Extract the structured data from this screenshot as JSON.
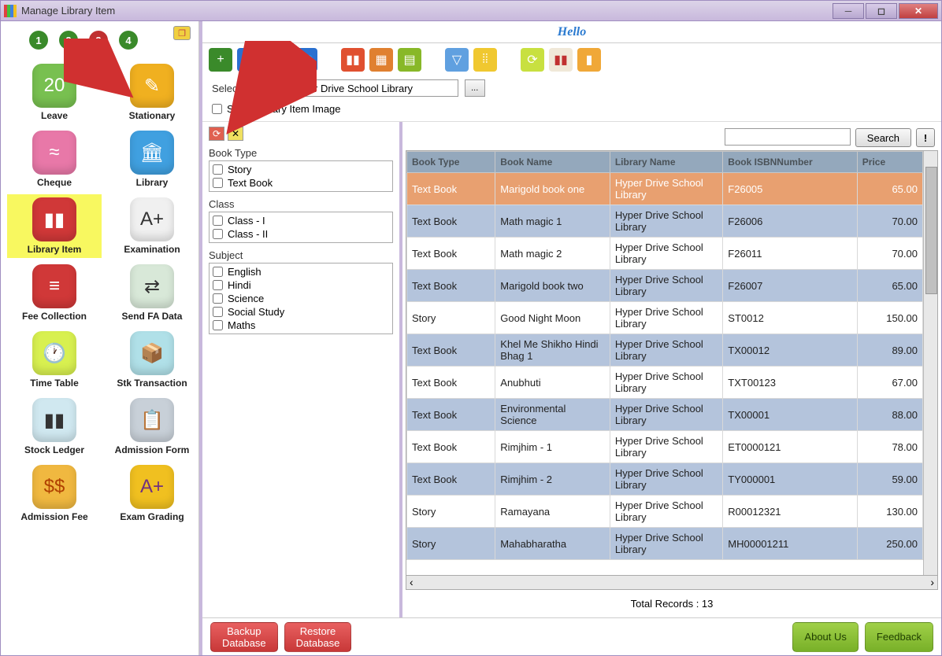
{
  "window": {
    "title": "Manage Library Item"
  },
  "header": {
    "hello": "Hello"
  },
  "steps": [
    "1",
    "2",
    "3",
    "4"
  ],
  "sidebar": [
    {
      "label": "Leave",
      "bg": "#78c050",
      "glyph": "20"
    },
    {
      "label": "Stationary",
      "bg": "#f0b020",
      "glyph": "✎"
    },
    {
      "label": "Cheque",
      "bg": "#e878a8",
      "glyph": "≈"
    },
    {
      "label": "Library",
      "bg": "#40a0e0",
      "glyph": "🏛"
    },
    {
      "label": "Library Item",
      "bg": "#d03838",
      "glyph": "▮▮",
      "sel": true
    },
    {
      "label": "Examination",
      "bg": "#f0f0f0",
      "glyph": "A+",
      "fg": "#333"
    },
    {
      "label": "Fee Collection",
      "bg": "#d03838",
      "glyph": "≡"
    },
    {
      "label": "Send FA Data",
      "bg": "#d8e8d8",
      "glyph": "⇄",
      "fg": "#333"
    },
    {
      "label": "Time Table",
      "bg": "#d8f050",
      "glyph": "🕐",
      "fg": "#333"
    },
    {
      "label": "Stk Transaction",
      "bg": "#b0e0e8",
      "glyph": "📦",
      "fg": "#333"
    },
    {
      "label": "Stock Ledger",
      "bg": "#d0e8f0",
      "glyph": "▮▮",
      "fg": "#333"
    },
    {
      "label": "Admission Form",
      "bg": "#c8d0d8",
      "glyph": "📋",
      "fg": "#333"
    },
    {
      "label": "Admission Fee",
      "bg": "#f0b840",
      "glyph": "$$",
      "fg": "#b04000"
    },
    {
      "label": "Exam Grading",
      "bg": "#f0c020",
      "glyph": "A+",
      "fg": "#703080"
    }
  ],
  "library": {
    "select_label": "Select Library :",
    "value": "Hyper Drive School Library",
    "show_image_label": "Show Library Item Image"
  },
  "filters": {
    "book_type": {
      "title": "Book Type",
      "opts": [
        "Story",
        "Text Book"
      ]
    },
    "class": {
      "title": "Class",
      "opts": [
        "Class - I",
        "Class - II"
      ]
    },
    "subject": {
      "title": "Subject",
      "opts": [
        "English",
        "Hindi",
        "Science",
        "Social Study",
        "Maths"
      ]
    }
  },
  "search": {
    "placeholder": "",
    "button": "Search",
    "exc": "!"
  },
  "grid": {
    "cols": [
      "Book Type",
      "Book Name",
      "Library Name",
      "Book ISBNNumber",
      "Price"
    ],
    "rows": [
      {
        "t": "Text Book",
        "n": "Marigold book one",
        "l": "Hyper Drive School Library",
        "i": "F26005",
        "p": "65.00",
        "sel": true
      },
      {
        "t": "Text Book",
        "n": "Math magic 1",
        "l": "Hyper Drive School Library",
        "i": "F26006",
        "p": "70.00",
        "alt": true
      },
      {
        "t": "Text Book",
        "n": "Math magic 2",
        "l": "Hyper Drive School Library",
        "i": "F26011",
        "p": "70.00"
      },
      {
        "t": "Text Book",
        "n": "Marigold book two",
        "l": "Hyper Drive School Library",
        "i": "F26007",
        "p": "65.00",
        "alt": true
      },
      {
        "t": "Story",
        "n": "Good Night Moon",
        "l": "Hyper Drive School Library",
        "i": "ST0012",
        "p": "150.00"
      },
      {
        "t": "Text Book",
        "n": "Khel Me Shikho Hindi Bhag 1",
        "l": "Hyper Drive School Library",
        "i": "TX00012",
        "p": "89.00",
        "alt": true
      },
      {
        "t": "Text Book",
        "n": "Anubhuti",
        "l": "Hyper Drive School Library",
        "i": "TXT00123",
        "p": "67.00"
      },
      {
        "t": "Text Book",
        "n": "Environmental Science",
        "l": "Hyper Drive School Library",
        "i": "TX00001",
        "p": "88.00",
        "alt": true
      },
      {
        "t": "Text Book",
        "n": "Rimjhim - 1",
        "l": "Hyper Drive School Library",
        "i": "ET0000121",
        "p": "78.00"
      },
      {
        "t": "Text Book",
        "n": "Rimjhim - 2",
        "l": "Hyper Drive School Library",
        "i": "TY000001",
        "p": "59.00",
        "alt": true
      },
      {
        "t": "Story",
        "n": "Ramayana",
        "l": "Hyper Drive School Library",
        "i": "R00012321",
        "p": "130.00"
      },
      {
        "t": "Story",
        "n": "Mahabharatha",
        "l": "Hyper Drive School Library",
        "i": "MH00001211",
        "p": "250.00",
        "alt": true
      }
    ],
    "total_label": "Total Records : 13"
  },
  "footer": {
    "backup": "Backup\nDatabase",
    "restore": "Restore\nDatabase",
    "about": "About Us",
    "feedback": "Feedback"
  },
  "toolbar": [
    {
      "bg": "#3a8a2a",
      "g": "+"
    },
    {
      "bg": "#2a70d0",
      "g": "✎"
    },
    {
      "bg": "#d03030",
      "g": "−"
    },
    {
      "bg": "#2a70d0",
      "g": "👥"
    },
    {
      "gap": true
    },
    {
      "bg": "#e05030",
      "g": "▮▮"
    },
    {
      "bg": "#e08030",
      "g": "▦"
    },
    {
      "bg": "#88b828",
      "g": "▤"
    },
    {
      "gap": true
    },
    {
      "bg": "#60a0e0",
      "g": "▽"
    },
    {
      "bg": "#f0c830",
      "g": "⦙⦙"
    },
    {
      "gap": true
    },
    {
      "bg": "#c8e040",
      "g": "⟳"
    },
    {
      "bg": "#f0e8d8",
      "g": "▮▮",
      "fg": "#c03030"
    },
    {
      "bg": "#f0a838",
      "g": "▮"
    }
  ]
}
